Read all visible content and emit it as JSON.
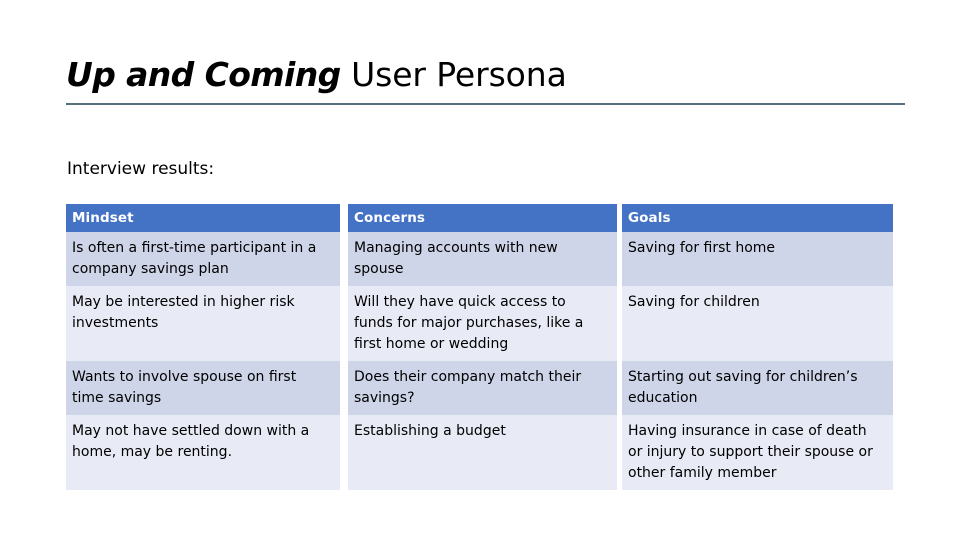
{
  "slide": {
    "title_emphasis": "Up and Coming",
    "title_rest": " User Persona",
    "subtitle": "Interview results:",
    "rule_color": "#56707E",
    "background_color": "#FFFFFF"
  },
  "table": {
    "header_fill": "#4472C4",
    "header_text_color": "#FFFFFF",
    "band_dark": "#CED5E9",
    "band_light": "#E8EBF6",
    "columns": [
      {
        "key": "mindset",
        "label": "Mindset"
      },
      {
        "key": "concerns",
        "label": "Concerns"
      },
      {
        "key": "goals",
        "label": "Goals"
      }
    ],
    "rows": [
      {
        "mindset": "Is often a first-time participant in a company savings plan",
        "concerns": "Managing accounts with new spouse",
        "goals": "Saving for first home"
      },
      {
        "mindset": "May be interested in higher risk investments",
        "concerns": "Will they have quick access to funds for major purchases, like a first home or wedding",
        "goals": "Saving for children"
      },
      {
        "mindset": "Wants to involve spouse on first time savings",
        "concerns": "Does their company match their savings?",
        "goals": "Starting out saving for children’s education"
      },
      {
        "mindset": "May not have settled down with a home, may be renting.",
        "concerns": "Establishing a budget",
        "goals": "Having insurance in case of death or injury to support their spouse or other family member"
      }
    ]
  }
}
